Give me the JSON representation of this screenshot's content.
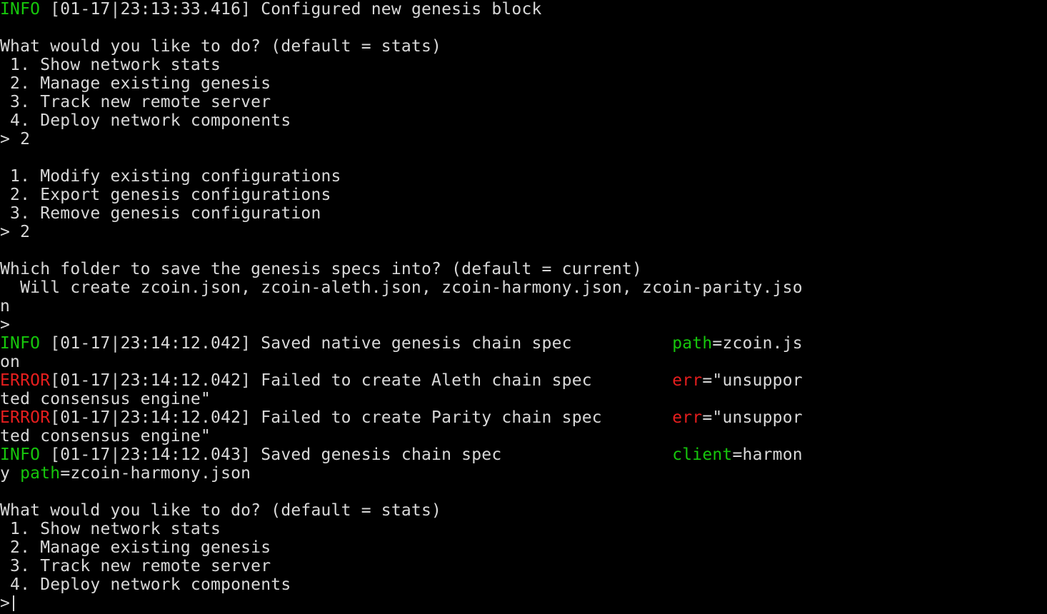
{
  "terminal": {
    "lines": [
      {
        "segments": [
          {
            "text": "INFO",
            "color": "#16c60c"
          },
          {
            "text": " [01-17|23:13:33.416] Configured new genesis block"
          }
        ]
      },
      {
        "segments": []
      },
      {
        "segments": [
          {
            "text": "What would you like to do? (default = stats)"
          }
        ]
      },
      {
        "segments": [
          {
            "text": " 1. Show network stats"
          }
        ]
      },
      {
        "segments": [
          {
            "text": " 2. Manage existing genesis"
          }
        ]
      },
      {
        "segments": [
          {
            "text": " 3. Track new remote server"
          }
        ]
      },
      {
        "segments": [
          {
            "text": " 4. Deploy network components"
          }
        ]
      },
      {
        "segments": [
          {
            "text": "> 2"
          }
        ]
      },
      {
        "segments": []
      },
      {
        "segments": [
          {
            "text": " 1. Modify existing configurations"
          }
        ]
      },
      {
        "segments": [
          {
            "text": " 2. Export genesis configurations"
          }
        ]
      },
      {
        "segments": [
          {
            "text": " 3. Remove genesis configuration"
          }
        ]
      },
      {
        "segments": [
          {
            "text": "> 2"
          }
        ]
      },
      {
        "segments": []
      },
      {
        "segments": [
          {
            "text": "Which folder to save the genesis specs into? (default = current)"
          }
        ]
      },
      {
        "segments": [
          {
            "text": "  Will create zcoin.json, zcoin-aleth.json, zcoin-harmony.json, zcoin-parity.jso"
          }
        ]
      },
      {
        "segments": [
          {
            "text": "n"
          }
        ]
      },
      {
        "segments": [
          {
            "text": ">"
          }
        ]
      },
      {
        "segments": [
          {
            "text": "INFO",
            "color": "#16c60c"
          },
          {
            "text": " [01-17|23:14:12.042] Saved native genesis chain spec          "
          },
          {
            "text": "path",
            "color": "#16c60c"
          },
          {
            "text": "=zcoin.js"
          }
        ]
      },
      {
        "segments": [
          {
            "text": "on"
          }
        ]
      },
      {
        "segments": [
          {
            "text": "ERROR",
            "color": "#e61e1e"
          },
          {
            "text": "[01-17|23:14:12.042] Failed to create Aleth chain spec        "
          },
          {
            "text": "err",
            "color": "#e61e1e"
          },
          {
            "text": "=\"unsuppor"
          }
        ]
      },
      {
        "segments": [
          {
            "text": "ted consensus engine\""
          }
        ]
      },
      {
        "segments": [
          {
            "text": "ERROR",
            "color": "#e61e1e"
          },
          {
            "text": "[01-17|23:14:12.042] Failed to create Parity chain spec       "
          },
          {
            "text": "err",
            "color": "#e61e1e"
          },
          {
            "text": "=\"unsuppor"
          }
        ]
      },
      {
        "segments": [
          {
            "text": "ted consensus engine\""
          }
        ]
      },
      {
        "segments": [
          {
            "text": "INFO",
            "color": "#16c60c"
          },
          {
            "text": " [01-17|23:14:12.043] Saved genesis chain spec                 "
          },
          {
            "text": "client",
            "color": "#16c60c"
          },
          {
            "text": "=harmon"
          }
        ]
      },
      {
        "segments": [
          {
            "text": "y "
          },
          {
            "text": "path",
            "color": "#16c60c"
          },
          {
            "text": "=zcoin-harmony.json"
          }
        ]
      },
      {
        "segments": []
      },
      {
        "segments": [
          {
            "text": "What would you like to do? (default = stats)"
          }
        ]
      },
      {
        "segments": [
          {
            "text": " 1. Show network stats"
          }
        ]
      },
      {
        "segments": [
          {
            "text": " 2. Manage existing genesis"
          }
        ]
      },
      {
        "segments": [
          {
            "text": " 3. Track new remote server"
          }
        ]
      },
      {
        "segments": [
          {
            "text": " 4. Deploy network components"
          }
        ]
      },
      {
        "segments": [
          {
            "text": ">"
          }
        ],
        "cursor": true
      }
    ]
  },
  "colors": {
    "background": "#000000",
    "text": "#d8d8d8",
    "info": "#16c60c",
    "error": "#e61e1e"
  }
}
